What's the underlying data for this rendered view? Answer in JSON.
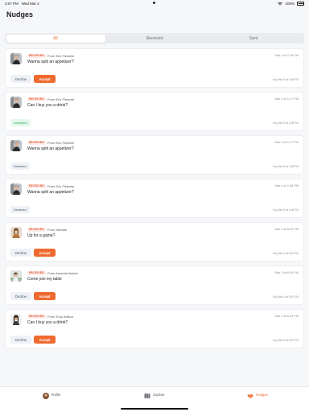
{
  "status_bar": {
    "time": "3:07 PM",
    "date": "Wed Mar 4",
    "battery": "100%"
  },
  "page": {
    "title": "Nudges"
  },
  "segments": [
    {
      "label": "All",
      "active": true
    },
    {
      "label": "Received",
      "active": false
    },
    {
      "label": "Sent",
      "active": false
    }
  ],
  "badge_label": "RECEIVED",
  "buttons": {
    "decline": "Decline",
    "accept": "Accept"
  },
  "nudges": [
    {
      "from": "From Eric Fleische",
      "sent": "Mar 4 at 1:18 PM",
      "message": "Wanna split an appetizer?",
      "state": "pending",
      "status_label": "",
      "expires": "Exp Mar 5 at 1:58 PM",
      "avatar": "man-dark"
    },
    {
      "from": "From Eric Fleische",
      "sent": "Mar 4 at 1:17 PM",
      "message": "Can I buy you a drink?",
      "state": "accepted",
      "status_label": "Accepted",
      "expires": "Exp Mar 5 at 1:58 PM",
      "avatar": "man-dark"
    },
    {
      "from": "From Eric Fleische",
      "sent": "Mar 4 at 1:17 PM",
      "message": "Wanna split an appetizer?",
      "state": "declined",
      "status_label": "Declined",
      "expires": "Exp Mar 5 at 1:58 PM",
      "avatar": "man-dark"
    },
    {
      "from": "From Eric Fleische",
      "sent": "Mar 4 at 1:08 PM",
      "message": "Wanna split an appetizer?",
      "state": "declined",
      "status_label": "Declined",
      "expires": "Exp Mar 5 at 1:58 PM",
      "avatar": "man-dark"
    },
    {
      "from": "From Michael",
      "sent": "Mar 3 at 6:43 PM",
      "message": "Up for a game?",
      "state": "pending",
      "status_label": "",
      "expires": "Exp Mar 4 at 6:43 PM",
      "avatar": "woman-brown"
    },
    {
      "from": "From Amanda Barker",
      "sent": "Mar 3 at 6:30 PM",
      "message": "Come join my table",
      "state": "pending",
      "status_label": "",
      "expires": "Exp Mar 4 at 6:30 PM",
      "avatar": "person-outdoor"
    },
    {
      "from": "From Tony Wilson",
      "sent": "Mar 3 at 6:29 PM",
      "message": "Can I buy you a drink?",
      "state": "pending",
      "status_label": "",
      "expires": "Exp Mar 4 at 6:29 PM",
      "avatar": "woman-dark-hair"
    }
  ],
  "tabbar": [
    {
      "label": "Profile",
      "icon": "profile-avatar-icon",
      "active": false
    },
    {
      "label": "Explore",
      "icon": "map-icon",
      "active": false
    },
    {
      "label": "Nudges",
      "icon": "handshake-icon",
      "active": true
    }
  ],
  "colors": {
    "accent": "#ef6a2e",
    "accepted": "#22a559",
    "badge": "#e2552a"
  }
}
